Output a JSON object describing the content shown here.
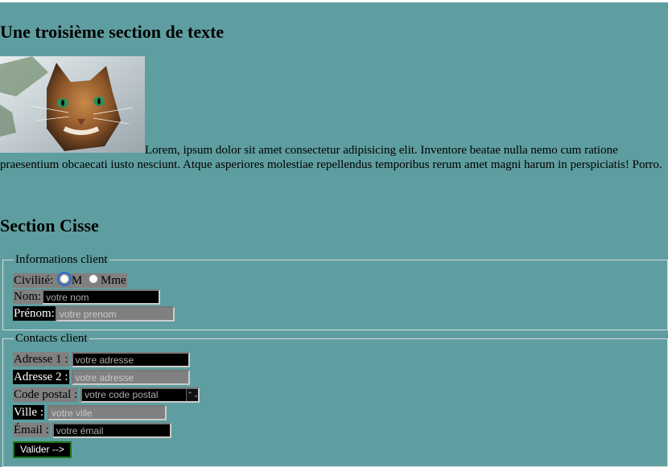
{
  "sections": {
    "third_title": "Une troisième section de texte",
    "paragraph": "Lorem, ipsum dolor sit amet consectetur adipisicing elit. Inventore beatae nulla nemo cum ratione praesentium obcaecati iusto nesciunt. Atque asperiores molestiae repellendus temporibus rerum amet magni harum in perspiciatis! Porro.",
    "cisse_title": "Section Cisse"
  },
  "form": {
    "info_legend": "Informations client",
    "civilite_label": "Civilité:",
    "radio_m": "M",
    "radio_mme": "Mme",
    "nom_label": "Nom:",
    "nom_placeholder": "votre nom",
    "prenom_label": "Prénom:",
    "prenom_placeholder": "votre prenom",
    "contact_legend": "Contacts client",
    "adresse1_label": "Adresse 1 :",
    "adresse1_placeholder": "votre adresse",
    "adresse2_label": "Adresse 2 :",
    "adresse2_placeholder": "votre adresse",
    "cp_label": "Code postal :",
    "cp_placeholder": "votre code postal",
    "ville_label": "Ville :",
    "ville_placeholder": "votre ville",
    "email_label": "Émail :",
    "email_placeholder": "votre émail",
    "submit_label": "Valider -->"
  },
  "colors": {
    "page_background": "#5f9ea0",
    "label_grey": "#808080",
    "label_black": "#000000",
    "button_border": "#1a7a1a"
  },
  "icons": {
    "image": "cat-photo",
    "spinner": "number-spinner-icon"
  }
}
